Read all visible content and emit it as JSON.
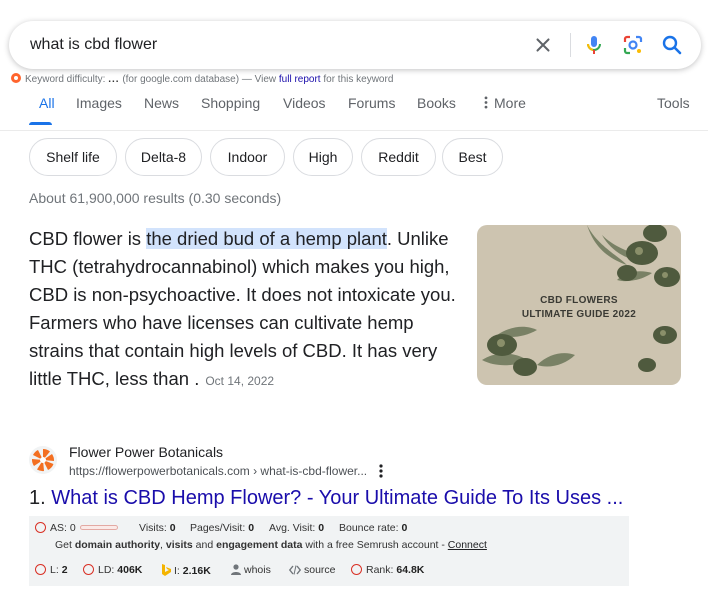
{
  "search": {
    "query": "what is cbd flower"
  },
  "keyword_bar": {
    "label": "Keyword difficulty:",
    "dots": "...",
    "database_note": "(for google.com database) — View",
    "link": "full report",
    "suffix": "for this keyword"
  },
  "tabs": {
    "items": [
      "All",
      "Images",
      "News",
      "Shopping",
      "Videos",
      "Forums",
      "Books",
      "More"
    ],
    "active": "All",
    "tools": "Tools"
  },
  "chips": [
    "Shelf life",
    "Delta-8",
    "Indoor",
    "High",
    "Reddit",
    "Best"
  ],
  "stats": "About 61,900,000 results (0.30 seconds)",
  "featured_snippet": {
    "before": "CBD flower is ",
    "highlight": "the dried bud of a hemp plant",
    "after": ". Unlike THC (tetrahydrocannabinol) which makes you high, CBD is non-psychoactive. It does not intoxicate you. Farmers who have licenses can cultivate hemp strains that contain high levels of CBD. It has very little THC, less than .",
    "date": "Oct 14, 2022",
    "image_line1": "CBD FLOWERS",
    "image_line2": "ULTIMATE GUIDE 2022"
  },
  "result": {
    "site_name": "Flower Power Botanicals",
    "url": "https://flowerpowerbotanicals.com › what-is-cbd-flower...",
    "number": "1.",
    "title": "What is CBD Hemp Flower? - Your Ultimate Guide To Its Uses ..."
  },
  "semrush": {
    "as_label": "AS:",
    "as_value": "0",
    "visits_label": "Visits:",
    "visits_value": "0",
    "pages_label": "Pages/Visit:",
    "pages_value": "0",
    "avg_label": "Avg. Visit:",
    "avg_value": "0",
    "bounce_label": "Bounce rate:",
    "bounce_value": "0",
    "promo_get": "Get",
    "promo_b1": "domain authority",
    "promo_sep1": ",",
    "promo_b2": "visits",
    "promo_and": "and",
    "promo_b3": "engagement data",
    "promo_rest": "with a free Semrush account -",
    "promo_link": "Connect",
    "l_label": "L:",
    "l_value": "2",
    "ld_label": "LD:",
    "ld_value": "406K",
    "i_label": "I:",
    "i_value": "2.16K",
    "whois": "whois",
    "source": "source",
    "rank_label": "Rank:",
    "rank_value": "64.8K"
  },
  "colors": {
    "link": "#1a0dab",
    "accent": "#1a73e8",
    "highlight": "#d2e3fc",
    "semrush_red": "#d93025"
  }
}
